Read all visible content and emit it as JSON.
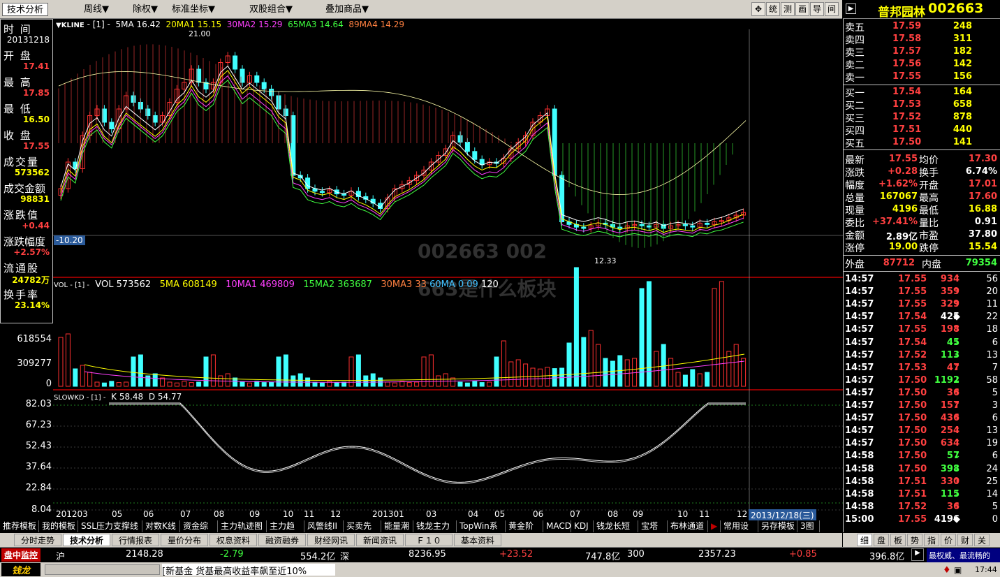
{
  "toolbar": {
    "tab_label": "技术分析",
    "menus": [
      "周线▼",
      "除权▼",
      "标准坐标▼",
      "双股组合▼",
      "叠加商品▼"
    ],
    "buttons": [
      "✥",
      "统",
      "测",
      "画",
      "导",
      "间"
    ]
  },
  "stock": {
    "name": "普邦园林",
    "code": "002663"
  },
  "info": {
    "date": "20131218",
    "open": "17.41",
    "high": "17.85",
    "low": "16.50",
    "close": "17.55",
    "volume": "573562",
    "amount": "98831",
    "change": "+0.44",
    "change_pct": "+2.57%",
    "float_shares": "24782万",
    "turnover": "23.14%",
    "labels": {
      "time": "时 间",
      "open": "开 盘",
      "high": "最 高",
      "low": "最 低",
      "close": "收 盘",
      "volume": "成交量",
      "amount": "成交金额",
      "change": "涨跌值",
      "change_pct": "涨跌幅度",
      "float": "流通股",
      "turnover": "换手率"
    }
  },
  "kline": {
    "header_label": "▼KLINE",
    "param": "- [1] -",
    "ma5": "5MA 16.42",
    "ma20": "20MA1 15.15",
    "ma30": "30MA2 15.29",
    "ma65": "65MA3 14.64",
    "ma89": "89MA4 14.29",
    "high_mark": "21.00",
    "low_mark": "12.33",
    "cursor_value": "-10.20",
    "watermark1": "002663 002",
    "watermark2": "663是什么板块"
  },
  "vol": {
    "header": "VOL - [1] -",
    "vol": "VOL 573562",
    "ma5": "5MA 608149",
    "ma10": "10MA1 469809",
    "ma15": "15MA2 363687",
    "ma30": "30MA3 33 ",
    "ma60": "60MA  0  09",
    "ma120": "120 ",
    "axis": [
      "618554",
      "309277",
      "0"
    ]
  },
  "kd": {
    "header": "SLOWKD - [1] -",
    "k": "K 58.48",
    "d": "D 54.77",
    "axis": [
      "82.03",
      "67.23",
      "52.43",
      "37.64",
      "22.84",
      "8.04"
    ]
  },
  "xaxis": {
    "labels": [
      "201203",
      "05",
      "06",
      "07",
      "08",
      "09",
      "10",
      "11",
      "12",
      "201301",
      "03",
      "04",
      "05",
      "06",
      "07",
      "08",
      "09",
      "10",
      "11",
      "12"
    ],
    "cursor_date": "2013/12/18(三)"
  },
  "orderbook": {
    "sells": [
      {
        "label": "卖五",
        "price": "17.59",
        "vol": "248"
      },
      {
        "label": "卖四",
        "price": "17.58",
        "vol": "311"
      },
      {
        "label": "卖三",
        "price": "17.57",
        "vol": "182"
      },
      {
        "label": "卖二",
        "price": "17.56",
        "vol": "142"
      },
      {
        "label": "卖一",
        "price": "17.55",
        "vol": "156"
      }
    ],
    "buys": [
      {
        "label": "买一",
        "price": "17.54",
        "vol": "164"
      },
      {
        "label": "买二",
        "price": "17.53",
        "vol": "658"
      },
      {
        "label": "买三",
        "price": "17.52",
        "vol": "878"
      },
      {
        "label": "买四",
        "price": "17.51",
        "vol": "440"
      },
      {
        "label": "买五",
        "price": "17.50",
        "vol": "141"
      }
    ]
  },
  "quote": [
    {
      "l1": "最新",
      "v1": "17.55",
      "l2": "均价",
      "v2": "17.30",
      "c1": "#ff4040",
      "c2": "#ff4040"
    },
    {
      "l1": "涨跌",
      "v1": "+0.28",
      "l2": "换手",
      "v2": "6.74%",
      "c1": "#ff4040",
      "c2": "#ffffff"
    },
    {
      "l1": "幅度",
      "v1": "+1.62%",
      "l2": "开盘",
      "v2": "17.01",
      "c1": "#ff4040",
      "c2": "#ff4040"
    },
    {
      "l1": "总量",
      "v1": "167067",
      "l2": "最高",
      "v2": "17.60",
      "c1": "#ffff00",
      "c2": "#ff4040"
    },
    {
      "l1": "现量",
      "v1": "4196",
      "l2": "最低",
      "v2": "16.88",
      "c1": "#ffff00",
      "c2": "#ffff00"
    },
    {
      "l1": "委比",
      "v1": "+37.41%",
      "l2": "量比",
      "v2": "0.91",
      "c1": "#ff4040",
      "c2": "#ffffff"
    },
    {
      "l1": "金额",
      "v1": "2.89亿",
      "l2": "市盈",
      "v2": "37.80",
      "c1": "#ffffff",
      "c2": "#ffffff"
    },
    {
      "l1": "涨停",
      "v1": "19.00",
      "l2": "跌停",
      "v2": "15.54",
      "c1": "#ffff00",
      "c2": "#ffff00"
    }
  ],
  "outer": {
    "l1": "外盘",
    "v1": "87712",
    "l2": "内盘",
    "v2": "79354"
  },
  "ticks": [
    [
      "14:57",
      "17.55",
      "934",
      "↑",
      "56"
    ],
    [
      "14:57",
      "17.55",
      "359",
      "↑",
      "20"
    ],
    [
      "14:57",
      "17.55",
      "329",
      "↑",
      "11"
    ],
    [
      "14:57",
      "17.54",
      "425",
      "◆",
      "22"
    ],
    [
      "14:57",
      "17.55",
      "198",
      "↑",
      "18"
    ],
    [
      "14:57",
      "17.54",
      "45",
      "↓",
      "6"
    ],
    [
      "14:57",
      "17.52",
      "113",
      "↓",
      "13"
    ],
    [
      "14:57",
      "17.53",
      "47",
      "↑",
      "7"
    ],
    [
      "14:57",
      "17.50",
      "1192",
      "↓",
      "58"
    ],
    [
      "14:57",
      "17.50",
      "36",
      "↑",
      "5"
    ],
    [
      "14:57",
      "17.50",
      "157",
      "↑",
      "3"
    ],
    [
      "14:57",
      "17.50",
      "436",
      "↑",
      "6"
    ],
    [
      "14:57",
      "17.50",
      "254",
      "↑",
      "13"
    ],
    [
      "14:57",
      "17.50",
      "634",
      "↑",
      "19"
    ],
    [
      "14:58",
      "17.50",
      "57",
      "↓",
      "6"
    ],
    [
      "14:58",
      "17.50",
      "398",
      "↓",
      "24"
    ],
    [
      "14:58",
      "17.51",
      "330",
      "↑",
      "25"
    ],
    [
      "14:58",
      "17.51",
      "115",
      "↓",
      "14"
    ],
    [
      "14:58",
      "17.52",
      "36",
      "↑",
      "5"
    ],
    [
      "15:00",
      "17.55",
      "4196",
      "◆",
      "0"
    ]
  ],
  "bottom_tabs": [
    "推荐模板",
    "我的模板",
    "SSL压力支撑线",
    "对数K线",
    "资金综合",
    "主力轨迹图",
    "主力趋势",
    "风警线II",
    "买卖先锋",
    "能量潮",
    "钱龙主力",
    "TopWin系列",
    "黄金阶梯",
    "MACD",
    "KDJ",
    "钱龙长短线",
    "宝塔线",
    "布林通道",
    "▶",
    "常用设置",
    "另存模板",
    "3图"
  ],
  "page_tabs": [
    "分时走势",
    "技术分析",
    "行情报表",
    "量价分布",
    "权息资料",
    "融资融券",
    "财经网讯",
    "新闻资讯",
    "Ｆ１０",
    "基本资料"
  ],
  "right_tabs": [
    "细",
    "盘",
    "板",
    "势",
    "指",
    "价",
    "财",
    "关"
  ],
  "status": {
    "monitor": "盘中监控",
    "sh_label": "沪",
    "sh_index": "2148.28",
    "sh_chg": "-2.79",
    "sh_amt": "554.2亿",
    "sz_label": "深",
    "sz_index": "8236.95",
    "sz_chg": "+23.52",
    "sz_amt": "747.8亿",
    "b300_label": "300",
    "b300_index": "2357.23",
    "b300_chg": "+0.85",
    "b300_amt": "396.8亿",
    "marquee": "最权威、最流畅的"
  },
  "news": {
    "logo": "钱龙",
    "headline": "[新基金 货基最高收益率飙至近10%",
    "time": "17:44"
  }
}
